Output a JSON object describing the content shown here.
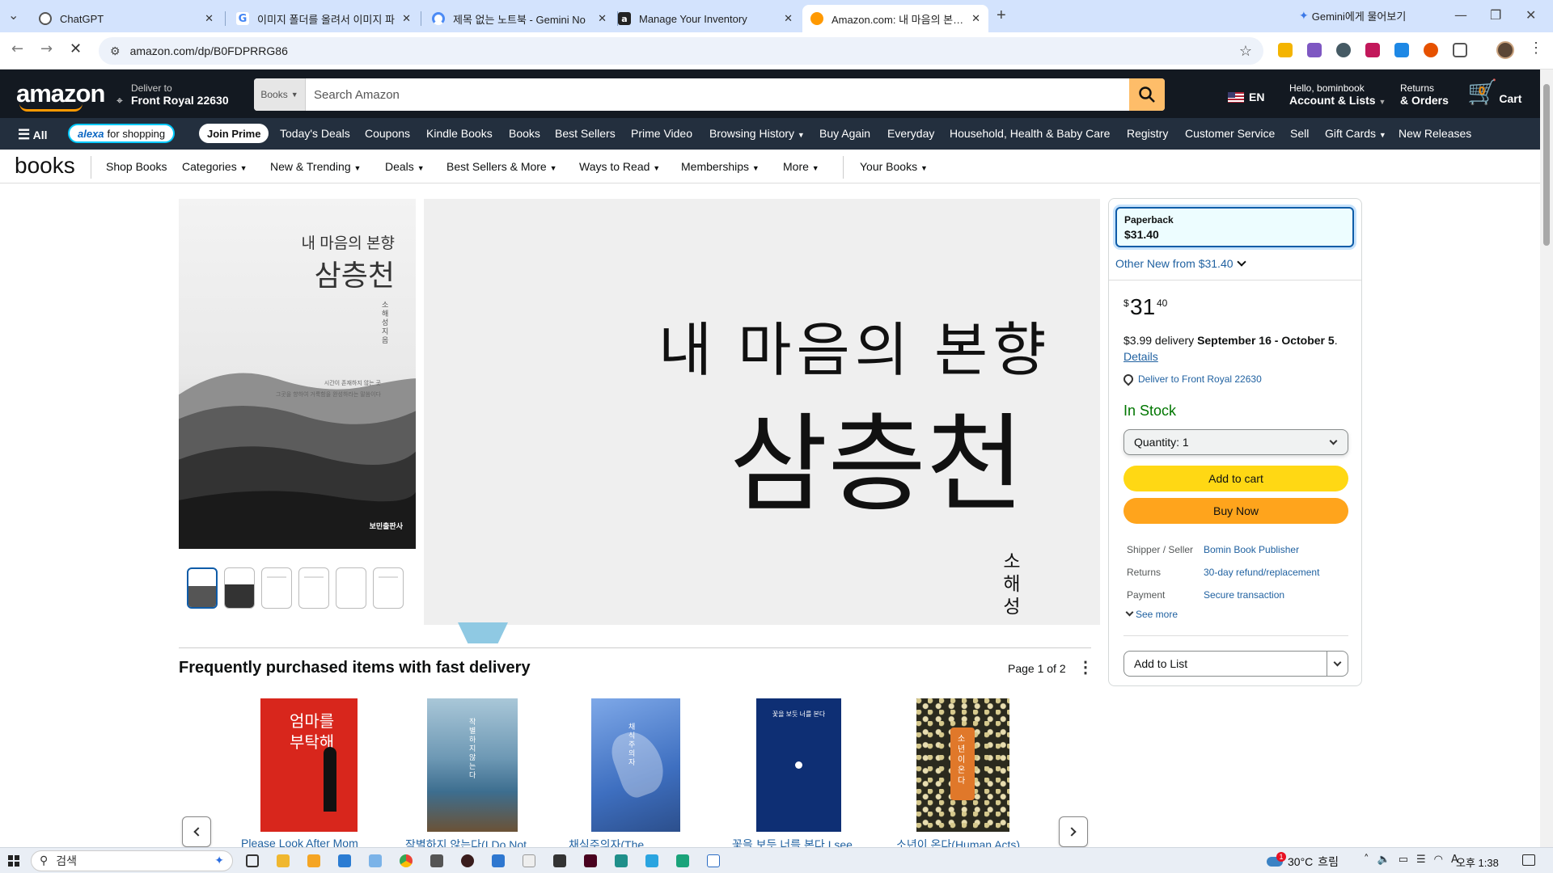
{
  "browser": {
    "tabs": [
      {
        "title": "ChatGPT",
        "icon": "chatgpt-icon",
        "active": false
      },
      {
        "title": "이미지 폴더를 올려서 이미지 파",
        "icon": "google-icon",
        "active": false
      },
      {
        "title": "제목 없는 노트북 - Gemini No",
        "icon": "gemini-notebook-icon",
        "active": false
      },
      {
        "title": "Manage Your Inventory",
        "icon": "amazon-icon",
        "active": false
      },
      {
        "title": "Amazon.com: 내 마음의 본향 삼",
        "icon": "amazon-smile-icon",
        "active": true
      }
    ],
    "gemini_ask": "Gemini에게 물어보기",
    "url": "amazon.com/dp/B0FDPRRG86",
    "extension_colors": [
      "#f4b400",
      "#7e57c2",
      "#455a64",
      "#c2185b",
      "#1e88e5",
      "#e65100",
      "#555555"
    ]
  },
  "amazon_nav": {
    "logo": "amazon",
    "deliver_label": "Deliver to",
    "deliver_location": "Front Royal 22630",
    "search_category": "Books",
    "search_placeholder": "Search Amazon",
    "language": "EN",
    "account_hello": "Hello, bominbook",
    "account_lists": "Account & Lists",
    "returns_label": "Returns",
    "orders_label": "& Orders",
    "cart_count": "0",
    "cart_label": "Cart"
  },
  "main_nav": {
    "all": "All",
    "alexa": "alexa",
    "alexa_suffix": "for shopping",
    "join_prime": "Join Prime",
    "items": [
      "Today's Deals",
      "Coupons",
      "Kindle Books",
      "Books",
      "Best Sellers",
      "Prime Video",
      "Browsing History",
      "Buy Again",
      "Everyday",
      "Household, Health & Baby Care",
      "Registry",
      "Customer Service",
      "Sell",
      "Gift Cards",
      "New Releases"
    ]
  },
  "books_nav": {
    "logo": "books",
    "items": [
      "Shop Books",
      "Categories",
      "New & Trending",
      "Deals",
      "Best Sellers & More",
      "Ways to Read",
      "Memberships",
      "More",
      "Your Books"
    ]
  },
  "product": {
    "cover_title_line1": "내 마음의 본향",
    "cover_title_line2": "삼층천",
    "cover_author": "소해성 지음",
    "cover_text_line1": "시간이 존재하지 않는 곳",
    "cover_text_line2": "그곳을 향하여 거룩함을 완성하라는 말씀이다",
    "cover_publisher": "보민출판사",
    "zoom_title_line1": "내 마음의 본향",
    "zoom_title_line2": "삼층천",
    "zoom_author": "소해성"
  },
  "buybox": {
    "format_name": "Paperback",
    "format_price": "$31.40",
    "other_new": "Other New from $31.40",
    "price_symbol": "$",
    "price_whole": "31",
    "price_fraction": "40",
    "delivery_fee": "$3.99 delivery",
    "delivery_dates": "September 16 - October 5",
    "details_link": "Details",
    "deliver_to": "Deliver to Front Royal 22630",
    "stock": "In Stock",
    "quantity_label": "Quantity:",
    "quantity_value": "1",
    "add_to_cart": "Add to cart",
    "buy_now": "Buy Now",
    "info": [
      {
        "label": "Shipper / Seller",
        "value": "Bomin Book Publisher"
      },
      {
        "label": "Returns",
        "value": "30-day refund/replacement"
      },
      {
        "label": "Payment",
        "value": "Secure transaction"
      }
    ],
    "see_more": "See more",
    "add_to_list": "Add to List"
  },
  "frequently_purchased": {
    "title": "Frequently purchased items with fast delivery",
    "page_indicator": "Page 1 of 2",
    "books": [
      {
        "title": "Please Look After Mom",
        "cover_color": "#d8261c",
        "cover_text": "엄마를 부탁해"
      },
      {
        "title": "작별하지 않는다(I Do Not",
        "cover_color": "#5d8aa3",
        "cover_text": "작별하지 않는다"
      },
      {
        "title": "채식주의자(The",
        "cover_color": "#4a7ec8",
        "cover_text": "채식주의자"
      },
      {
        "title": "꽃을 보듯 너를 본다 I see",
        "cover_color": "#0e2f74",
        "cover_text": "꽃을 보듯 너를 본다"
      },
      {
        "title": "소년이 온다(Human Acts)",
        "cover_color": "#2b2a1e",
        "cover_text": "소년이 온다"
      }
    ]
  },
  "taskbar": {
    "search_placeholder": "검색",
    "weather_temp": "30°C",
    "weather_desc": "흐림",
    "weather_badge": "1",
    "ime": "A",
    "time": "오후 1:38"
  }
}
